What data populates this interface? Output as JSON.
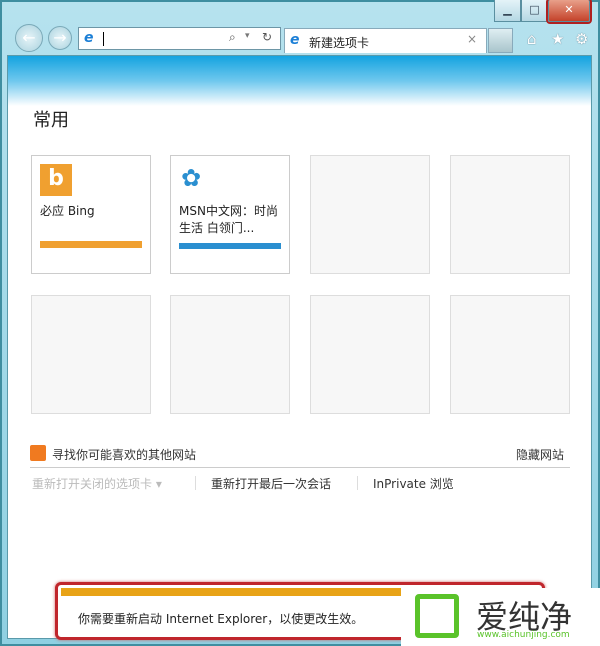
{
  "window": {
    "minimize": "▁",
    "maximize": "□",
    "close": "✕"
  },
  "toolbar": {
    "back": "←",
    "forward": "→",
    "address_value": "",
    "search_icon": "⌕",
    "dropdown": "▾",
    "refresh": "↻",
    "home": "⌂",
    "favorites": "★",
    "settings": "⚙"
  },
  "tab": {
    "label": "新建选项卡",
    "close": "×"
  },
  "page": {
    "heading": "常用",
    "tiles": [
      {
        "title": "必应 Bing",
        "color": "#f0a030"
      },
      {
        "title": "MSN中文网：时尚生活 白领门...",
        "color": "#2a8fd0"
      }
    ],
    "discover": "寻找你可能喜欢的其他网站",
    "hide": "隐藏网站",
    "reopen_closed": "重新打开关闭的选项卡 ▾",
    "reopen_last": "重新打开最后一次会话",
    "inprivate": "InPrivate 浏览"
  },
  "notification": {
    "message": "你需要重新启动 Internet Explorer，以使更改生效。"
  },
  "watermark": {
    "brand": "爱纯净",
    "url": "www.aichunjing.com"
  }
}
